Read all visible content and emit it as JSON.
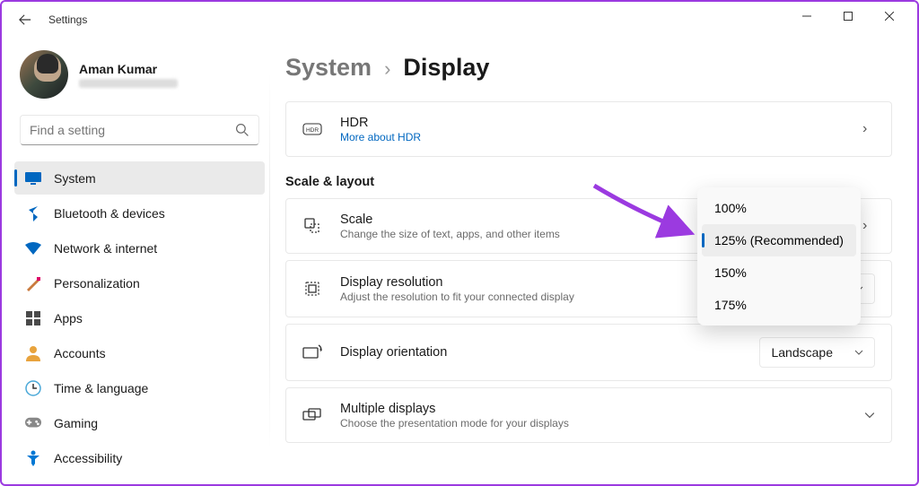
{
  "window": {
    "title": "Settings"
  },
  "account": {
    "name": "Aman Kumar"
  },
  "search": {
    "placeholder": "Find a setting"
  },
  "nav": [
    {
      "id": "system",
      "label": "System",
      "selected": true
    },
    {
      "id": "bluetooth",
      "label": "Bluetooth & devices"
    },
    {
      "id": "network",
      "label": "Network & internet"
    },
    {
      "id": "personalization",
      "label": "Personalization"
    },
    {
      "id": "apps",
      "label": "Apps"
    },
    {
      "id": "accounts",
      "label": "Accounts"
    },
    {
      "id": "time",
      "label": "Time & language"
    },
    {
      "id": "gaming",
      "label": "Gaming"
    },
    {
      "id": "accessibility",
      "label": "Accessibility"
    }
  ],
  "breadcrumb": {
    "parent": "System",
    "current": "Display"
  },
  "hdr": {
    "title": "HDR",
    "link": "More about HDR"
  },
  "sections": {
    "scale_layout": "Scale & layout"
  },
  "cards": {
    "scale": {
      "title": "Scale",
      "subtitle": "Change the size of text, apps, and other items"
    },
    "resolution": {
      "title": "Display resolution",
      "subtitle": "Adjust the resolution to fit your connected display"
    },
    "orientation": {
      "title": "Display orientation",
      "value": "Landscape"
    },
    "multi": {
      "title": "Multiple displays",
      "subtitle": "Choose the presentation mode for your displays"
    }
  },
  "scale_dropdown": {
    "options": [
      "100%",
      "125% (Recommended)",
      "150%",
      "175%"
    ],
    "selected_index": 1
  }
}
